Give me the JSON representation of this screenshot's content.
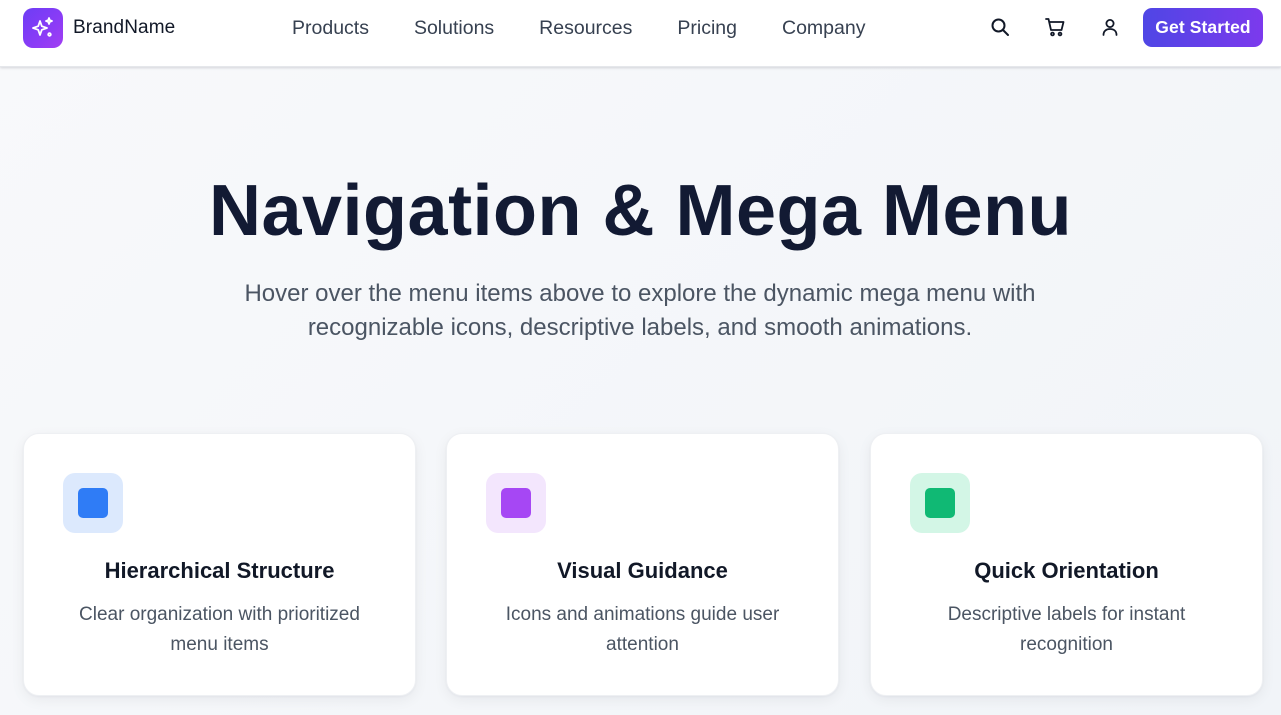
{
  "header": {
    "brand_name": "BrandName",
    "brand_icon": "sparkles-icon",
    "nav": [
      "Products",
      "Solutions",
      "Resources",
      "Pricing",
      "Company"
    ],
    "icons": [
      "search-icon",
      "cart-icon",
      "user-icon"
    ],
    "cta_label": "Get Started"
  },
  "hero": {
    "title": "Navigation & Mega Menu",
    "subtitle": "Hover over the menu items above to explore the dynamic mega menu with recognizable icons, descriptive labels, and smooth animations."
  },
  "cards": [
    {
      "title": "Hierarchical Structure",
      "description": "Clear organization with prioritized menu items",
      "accent": "#2f7cf6",
      "accent_bg": "#dce9fd"
    },
    {
      "title": "Visual Guidance",
      "description": "Icons and animations guide user attention",
      "accent": "#a647f4",
      "accent_bg": "#f3e6fd"
    },
    {
      "title": "Quick Orientation",
      "description": "Descriptive labels for instant recognition",
      "accent": "#10b974",
      "accent_bg": "#d3f6e6"
    }
  ],
  "colors": {
    "brand_gradient_start": "#6d3df5",
    "brand_gradient_end": "#a23ef2",
    "cta_gradient_start": "#4f46e5",
    "cta_gradient_end": "#7c3aed",
    "title_text": "#121a33",
    "body_text": "#4b5563"
  }
}
